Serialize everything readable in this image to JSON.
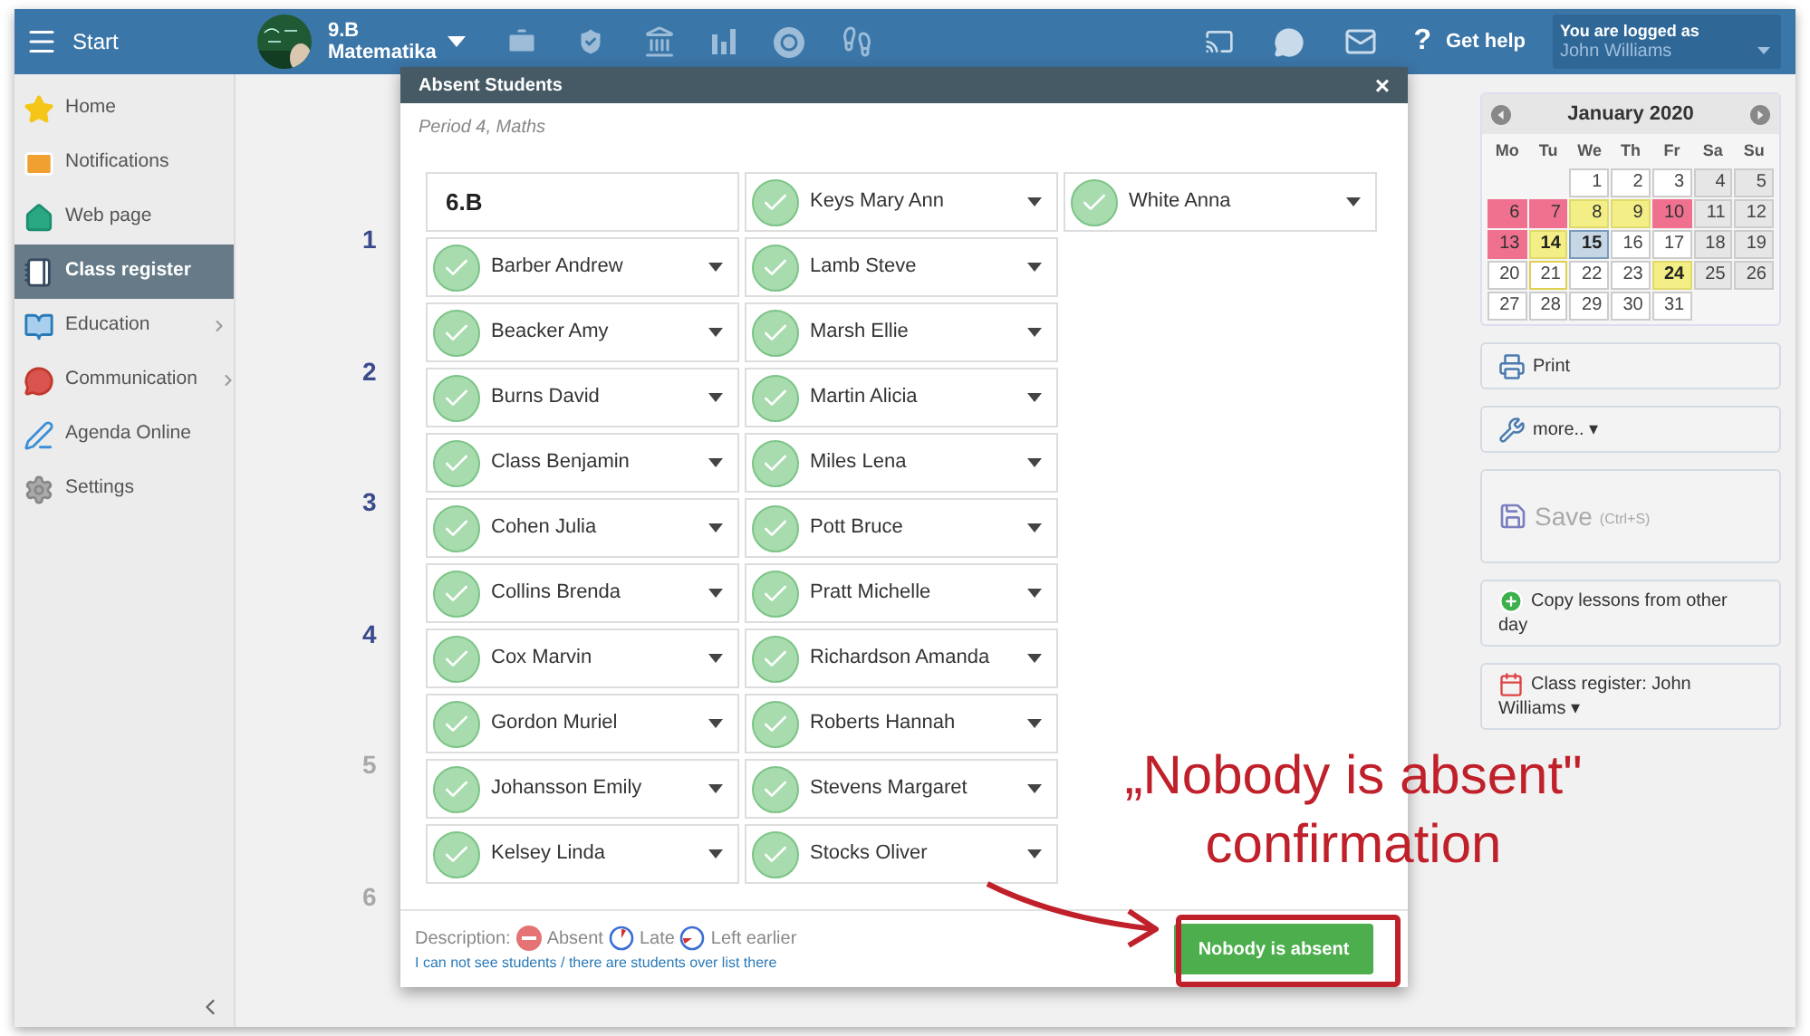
{
  "topbar": {
    "menu_label": "Start",
    "class_name": "9.B",
    "subject": "Matematika",
    "help_icon": "?",
    "help_label": "Get help",
    "login_caption": "You are logged as",
    "login_user": "John Williams"
  },
  "sidebar": {
    "items": [
      {
        "label": "Home",
        "selected": false,
        "has_submenu": false
      },
      {
        "label": "Notifications",
        "selected": false,
        "has_submenu": false
      },
      {
        "label": "Web page",
        "selected": false,
        "has_submenu": false
      },
      {
        "label": "Class register",
        "selected": true,
        "has_submenu": false
      },
      {
        "label": "Education",
        "selected": false,
        "has_submenu": true
      },
      {
        "label": "Communication",
        "selected": false,
        "has_submenu": true
      },
      {
        "label": "Agenda Online",
        "selected": false,
        "has_submenu": false
      },
      {
        "label": "Settings",
        "selected": false,
        "has_submenu": false
      }
    ]
  },
  "periods": [
    {
      "label": "1",
      "dimmed": false
    },
    {
      "label": "2",
      "dimmed": false
    },
    {
      "label": "3",
      "dimmed": false
    },
    {
      "label": "4",
      "dimmed": false
    },
    {
      "label": "5",
      "dimmed": true
    },
    {
      "label": "6",
      "dimmed": true
    }
  ],
  "dialog": {
    "title": "Absent Students",
    "close": "×",
    "subtitle": "Period 4, Maths",
    "class_label": "6.B",
    "students": [
      {
        "name": "Keys Mary Ann",
        "present": true
      },
      {
        "name": "White Anna",
        "present": true
      },
      {
        "name": "Barber Andrew",
        "present": true
      },
      {
        "name": "Lamb Steve",
        "present": true
      },
      {
        "name": "Beacker Amy",
        "present": true
      },
      {
        "name": "Marsh Ellie",
        "present": true
      },
      {
        "name": "Burns David",
        "present": true
      },
      {
        "name": "Martin Alicia",
        "present": true
      },
      {
        "name": "Class Benjamin",
        "present": true
      },
      {
        "name": "Miles Lena",
        "present": true
      },
      {
        "name": "Cohen Julia",
        "present": true
      },
      {
        "name": "Pott Bruce",
        "present": true
      },
      {
        "name": "Collins Brenda",
        "present": true
      },
      {
        "name": "Pratt Michelle",
        "present": true
      },
      {
        "name": "Cox Marvin",
        "present": true
      },
      {
        "name": "Richardson Amanda",
        "present": true
      },
      {
        "name": "Gordon Muriel",
        "present": true
      },
      {
        "name": "Roberts Hannah",
        "present": true
      },
      {
        "name": "Johansson Emily",
        "present": true
      },
      {
        "name": "Stevens Margaret",
        "present": true
      },
      {
        "name": "Kelsey Linda",
        "present": true
      },
      {
        "name": "Stocks Oliver",
        "present": true
      }
    ],
    "legend_label": "Description:",
    "legend": [
      {
        "kind": "absent",
        "label": "Absent"
      },
      {
        "kind": "late",
        "label": "Late"
      },
      {
        "kind": "left",
        "label": "Left earlier"
      }
    ],
    "help_link": "I can not see students / there are students over list there",
    "confirm_button": "Nobody is absent"
  },
  "calendar": {
    "title": "January 2020",
    "weekdays": [
      "Mo",
      "Tu",
      "We",
      "Th",
      "Fr",
      "Sa",
      "Su"
    ],
    "days": [
      {
        "day": "1",
        "kind": "plain"
      },
      {
        "day": "2",
        "kind": "plain"
      },
      {
        "day": "3",
        "kind": "plain"
      },
      {
        "day": "4",
        "kind": "weekend"
      },
      {
        "day": "5",
        "kind": "weekend"
      },
      {
        "day": "6",
        "kind": "red"
      },
      {
        "day": "7",
        "kind": "red"
      },
      {
        "day": "8",
        "kind": "yellow"
      },
      {
        "day": "9",
        "kind": "yellow"
      },
      {
        "day": "10",
        "kind": "red"
      },
      {
        "day": "11",
        "kind": "weekend"
      },
      {
        "day": "12",
        "kind": "weekend"
      },
      {
        "day": "13",
        "kind": "red"
      },
      {
        "day": "14",
        "kind": "marked"
      },
      {
        "day": "15",
        "kind": "selected"
      },
      {
        "day": "16",
        "kind": "plain"
      },
      {
        "day": "17",
        "kind": "plain"
      },
      {
        "day": "18",
        "kind": "weekend"
      },
      {
        "day": "19",
        "kind": "weekend"
      },
      {
        "day": "20",
        "kind": "plain"
      },
      {
        "day": "21",
        "kind": "outlined"
      },
      {
        "day": "22",
        "kind": "plain"
      },
      {
        "day": "23",
        "kind": "plain"
      },
      {
        "day": "24",
        "kind": "marked"
      },
      {
        "day": "25",
        "kind": "weekend"
      },
      {
        "day": "26",
        "kind": "weekend"
      },
      {
        "day": "27",
        "kind": "plain"
      },
      {
        "day": "28",
        "kind": "plain"
      },
      {
        "day": "29",
        "kind": "plain"
      },
      {
        "day": "30",
        "kind": "plain"
      },
      {
        "day": "31",
        "kind": "plain"
      }
    ]
  },
  "actions": [
    {
      "kind": "print",
      "label": "Print",
      "disabled": false
    },
    {
      "kind": "more",
      "label": "more..",
      "caret": "▾",
      "disabled": false
    },
    {
      "kind": "save",
      "label": "Save",
      "shortcut": "(Ctrl+S)",
      "disabled": true
    },
    {
      "kind": "copy",
      "label": "Copy lessons from other day",
      "disabled": false
    },
    {
      "kind": "register",
      "label": "Class register: John Williams",
      "caret": "▾",
      "disabled": false
    }
  ],
  "annotation": {
    "line_1": "„Nobody is absent\"",
    "line_2": "confirmation"
  }
}
